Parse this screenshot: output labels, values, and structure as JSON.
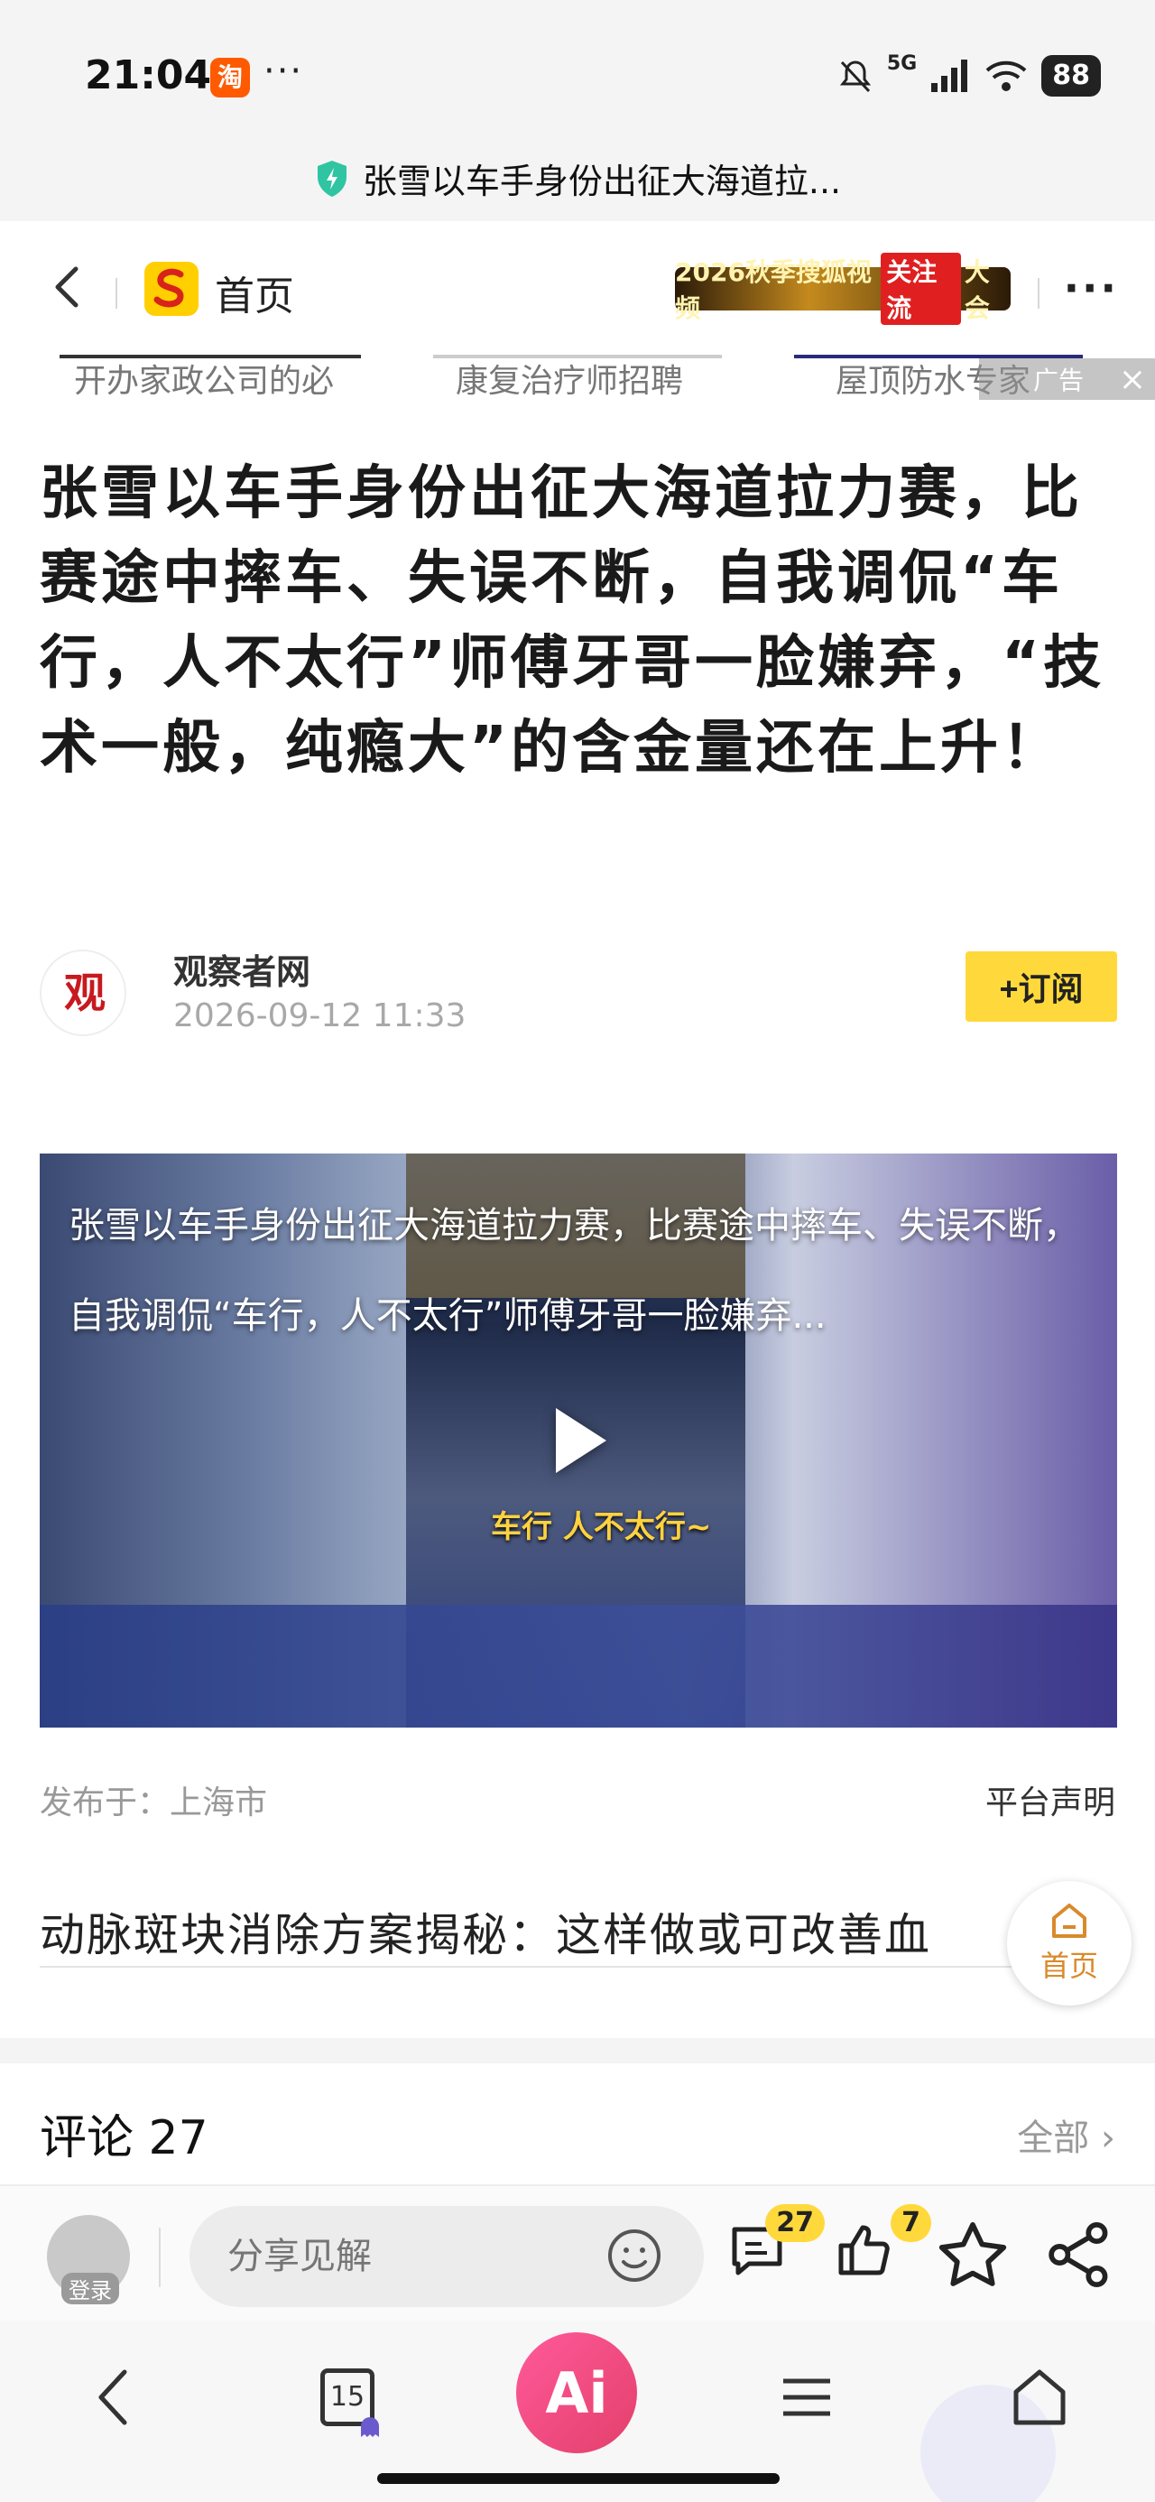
{
  "status": {
    "time": "21:04",
    "app_badge": "淘",
    "more": "···",
    "network": "5G",
    "battery": "88"
  },
  "urlbar": {
    "title": "张雪以车手身份出征大海道拉..."
  },
  "nav": {
    "home_label": "首页",
    "banner": {
      "pre": "2026秋季搜狐视频",
      "highlight": "关注流",
      "post": "大会"
    },
    "more": "···"
  },
  "ad_strip": {
    "items": [
      "开办家政公司的必",
      "康复治疗师招聘",
      "屋顶防水专家"
    ],
    "badge": "广告",
    "close": "×"
  },
  "article": {
    "title": "张雪以车手身份出征大海道拉力赛，比赛途中摔车、失误不断，自我调侃“车行，人不太行”师傅牙哥一脸嫌弃，“技术一般，纯瘾大”的含金量还在上升！",
    "author": "观察者网",
    "date": "2026-09-12 11:33",
    "subscribe": "+订阅",
    "avatar_glyph": "观"
  },
  "video": {
    "caption": "张雪以车手身份出征大海道拉力赛，比赛途中摔车、失误不断，自我调侃“车行，人不太行”师傅牙哥一脸嫌弃...",
    "subtitle": "车行 人不太行~"
  },
  "meta": {
    "publish_label": "发布于：",
    "publish_place": "上海市",
    "platform_statement": "平台声明"
  },
  "recommend": {
    "text": "动脉斑块消除方案揭秘：这样做或可改善血"
  },
  "home_float": {
    "label": "首页"
  },
  "comments": {
    "title": "评论 27",
    "all": "全部 ›"
  },
  "actionbar": {
    "login": "登录",
    "input_placeholder": "分享见解",
    "comment_count": "27",
    "like_count": "7"
  },
  "browser": {
    "tab_count": "15",
    "ai_label": "Ai"
  },
  "colors": {
    "accent_yellow": "#ffd93b",
    "home_orange": "#d98a2b",
    "ai_pink": "#e33f6b"
  }
}
